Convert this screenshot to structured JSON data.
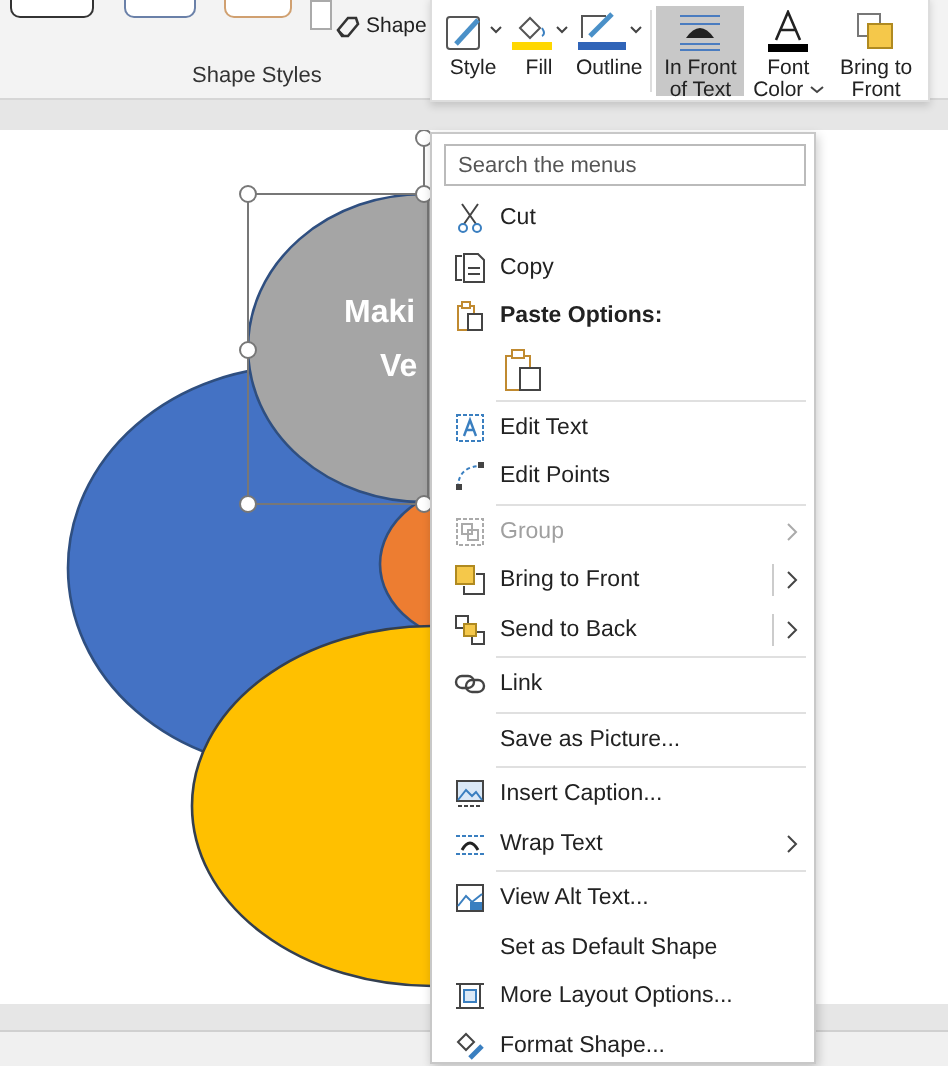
{
  "ribbon": {
    "group_label": "Shape Styles",
    "shape_button": "Shape"
  },
  "mini_toolbar": {
    "groups": [
      [
        {
          "label": "Style",
          "selected": false,
          "dropdown": true
        },
        {
          "label": "Fill",
          "selected": false,
          "dropdown": true
        },
        {
          "label": "Outline",
          "selected": false,
          "dropdown": true
        }
      ],
      [
        {
          "label": "In Front of Text",
          "selected": true,
          "dropdown": false
        },
        {
          "label": "Font Color",
          "selected": false,
          "dropdown": true
        },
        {
          "label": "Bring to Front",
          "selected": false,
          "dropdown": false
        }
      ]
    ]
  },
  "canvas": {
    "shape_text": [
      "Maki",
      "Ve"
    ]
  },
  "context_menu": {
    "search": {
      "placeholder": "Search the menus"
    },
    "groups": [
      [
        {
          "kind": "command",
          "label": "Cut",
          "disabled": false,
          "submenu": false,
          "split": false
        },
        {
          "kind": "command",
          "label": "Copy",
          "disabled": false,
          "submenu": false,
          "split": false
        },
        {
          "kind": "header",
          "label": "Paste Options:"
        },
        {
          "kind": "paste-option"
        }
      ],
      [
        {
          "kind": "command",
          "label": "Edit Text",
          "disabled": false,
          "submenu": false,
          "split": false
        },
        {
          "kind": "command",
          "label": "Edit Points",
          "disabled": false,
          "submenu": false,
          "split": false
        }
      ],
      [
        {
          "kind": "command",
          "label": "Group",
          "disabled": true,
          "submenu": true,
          "split": false
        },
        {
          "kind": "command",
          "label": "Bring to Front",
          "disabled": false,
          "submenu": true,
          "split": true
        },
        {
          "kind": "command",
          "label": "Send to Back",
          "disabled": false,
          "submenu": true,
          "split": true
        }
      ],
      [
        {
          "kind": "command",
          "label": "Link",
          "disabled": false,
          "submenu": false,
          "split": false
        }
      ],
      [
        {
          "kind": "command",
          "label": "Save as Picture...",
          "disabled": false,
          "submenu": false,
          "split": false
        }
      ],
      [
        {
          "kind": "command",
          "label": "Insert Caption...",
          "disabled": false,
          "submenu": false,
          "split": false
        },
        {
          "kind": "command",
          "label": "Wrap Text",
          "disabled": false,
          "submenu": true,
          "split": false
        }
      ],
      [
        {
          "kind": "command",
          "label": "View Alt Text...",
          "disabled": false,
          "submenu": false,
          "split": false
        },
        {
          "kind": "command",
          "label": "Set as Default Shape",
          "disabled": false,
          "submenu": false,
          "split": false
        },
        {
          "kind": "command",
          "label": "More Layout Options...",
          "disabled": false,
          "submenu": false,
          "split": false
        },
        {
          "kind": "command",
          "label": "Format Shape...",
          "disabled": false,
          "submenu": false,
          "split": false
        }
      ]
    ]
  }
}
